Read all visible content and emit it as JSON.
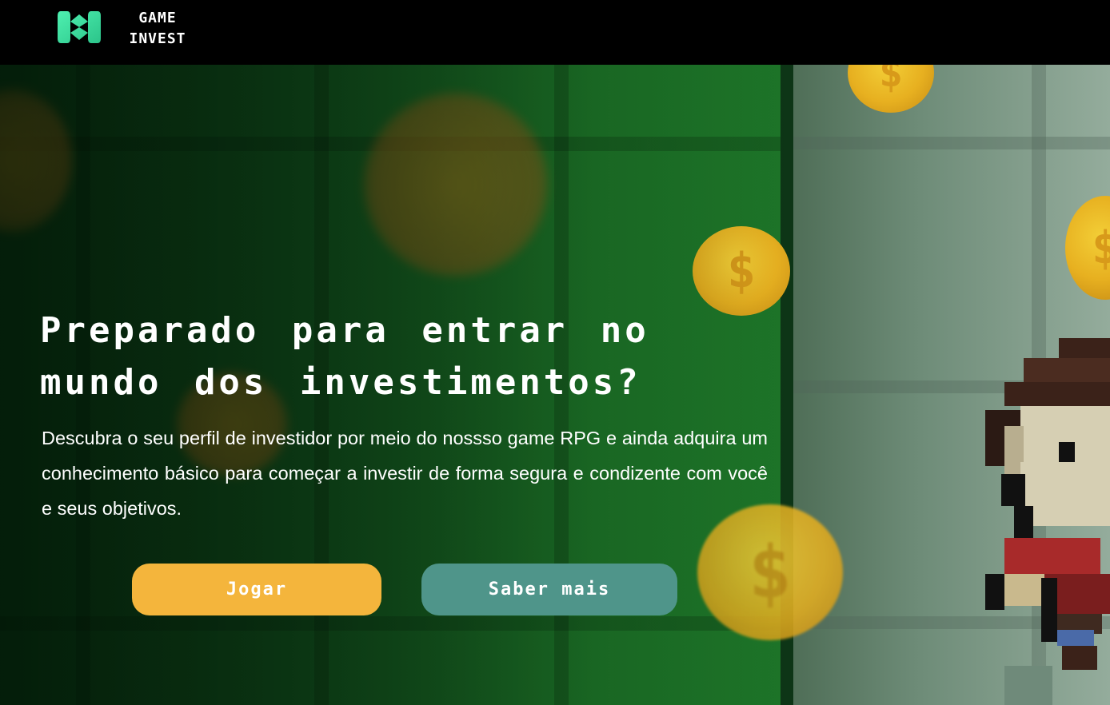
{
  "navbar": {
    "brand_line1": "GAME",
    "brand_line2": "INVEST",
    "logo_icon": "game-invest-logo-icon"
  },
  "hero": {
    "title": "Preparado para entrar no mundo dos investimentos?",
    "description": "Descubra o seu perfil de investidor por meio do nossso game RPG e ainda adquira um conhecimento básico para começar a investir de forma segura e condizente com você e seus objetivos.",
    "play_button": "Jogar",
    "learn_more_button": "Saber mais"
  },
  "colors": {
    "navbar_bg": "#000000",
    "play_button_bg": "#f4b53c",
    "learn_more_button_bg": "#4f958a",
    "text": "#ffffff",
    "logo_accent": "#3ddc97"
  }
}
